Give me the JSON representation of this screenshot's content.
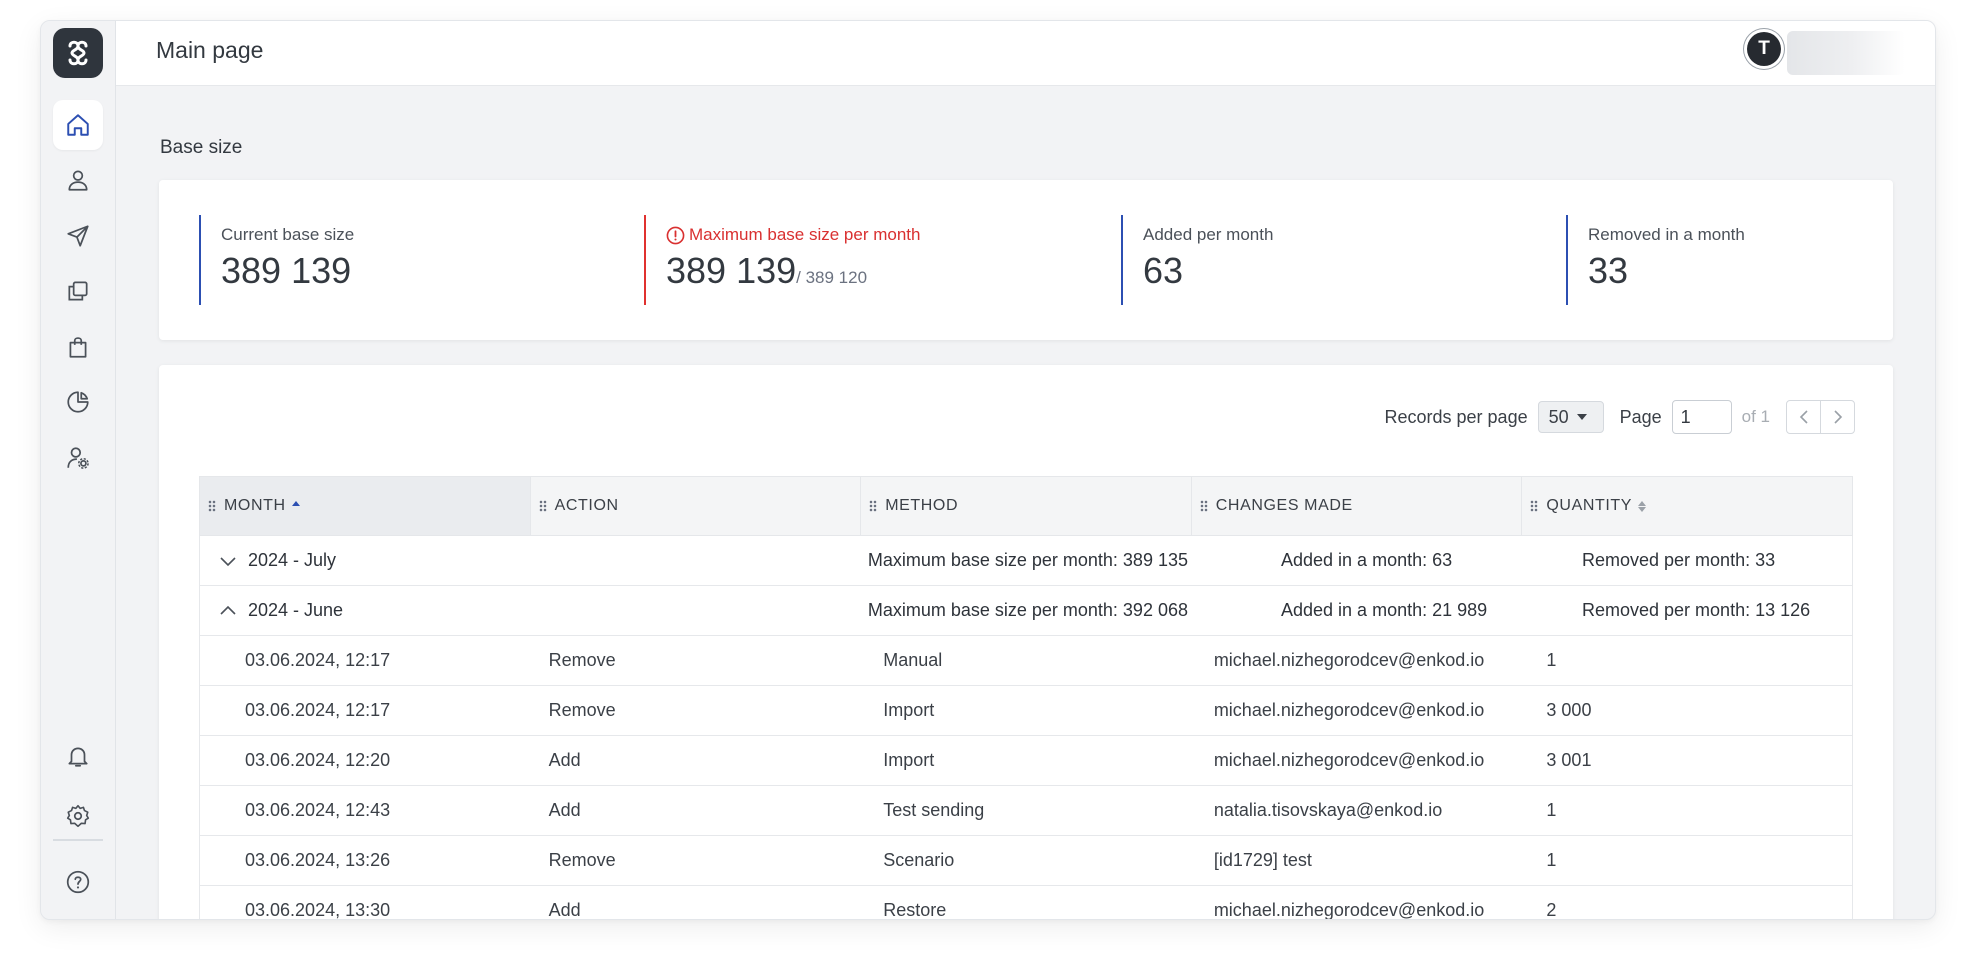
{
  "header": {
    "title": "Main page",
    "avatar_letter": "T"
  },
  "sidebar": {
    "items": [
      {
        "icon": "home-icon",
        "active": true
      },
      {
        "icon": "user-icon"
      },
      {
        "icon": "send-icon"
      },
      {
        "icon": "copy-icon"
      },
      {
        "icon": "shopping-bag-icon"
      },
      {
        "icon": "pie-chart-icon"
      },
      {
        "icon": "user-settings-icon"
      }
    ],
    "bottom_items": [
      {
        "icon": "bell-icon"
      },
      {
        "icon": "gear-icon"
      },
      {
        "icon": "help-icon"
      }
    ]
  },
  "base_size": {
    "title": "Base size",
    "stats": [
      {
        "label": "Current base size",
        "value": "389 139"
      },
      {
        "label": "Maximum base size per month",
        "value": "389 139",
        "sub": "/ 389 120",
        "warning": true
      },
      {
        "label": "Added per month",
        "value": "63"
      },
      {
        "label": "Removed in a month",
        "value": "33"
      }
    ]
  },
  "pager": {
    "records_label": "Records per page",
    "records_value": "50",
    "page_label": "Page",
    "page_value": "1",
    "of_text": "of 1"
  },
  "table": {
    "columns": [
      "MONTH",
      "ACTION",
      "METHOD",
      "CHANGES MADE",
      "QUANTITY"
    ],
    "groups": [
      {
        "label": "2024 - July",
        "expanded": false,
        "max": "Maximum base size per month: 389 135",
        "added": "Added in a month: 63",
        "removed": "Removed per month: 33"
      },
      {
        "label": "2024 - June",
        "expanded": true,
        "max": "Maximum base size per month: 392 068",
        "added": "Added in a month: 21 989",
        "removed": "Removed per month: 13 126"
      }
    ],
    "rows": [
      [
        "03.06.2024, 12:17",
        "Remove",
        "Manual",
        "michael.nizhegorodcev@enkod.io",
        "1"
      ],
      [
        "03.06.2024, 12:17",
        "Remove",
        "Import",
        "michael.nizhegorodcev@enkod.io",
        "3 000"
      ],
      [
        "03.06.2024, 12:20",
        "Add",
        "Import",
        "michael.nizhegorodcev@enkod.io",
        "3 001"
      ],
      [
        "03.06.2024, 12:43",
        "Add",
        "Test sending",
        "natalia.tisovskaya@enkod.io",
        "1"
      ],
      [
        "03.06.2024, 13:26",
        "Remove",
        "Scenario",
        "[id1729] test",
        "1"
      ],
      [
        "03.06.2024, 13:30",
        "Add",
        "Restore",
        "michael.nizhegorodcev@enkod.io",
        "2"
      ]
    ]
  },
  "colors": {
    "accent": "#2c4fb2",
    "warning": "#e0312f",
    "dark": "#2f353d"
  }
}
